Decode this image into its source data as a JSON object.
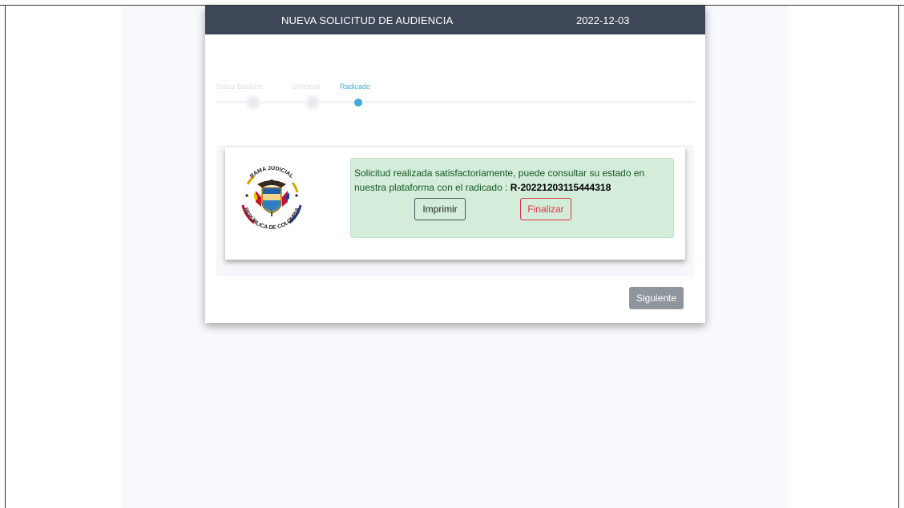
{
  "modal": {
    "title": "NUEVA SOLICITUD DE AUDIENCIA",
    "date": "2022-12-03"
  },
  "stepper": {
    "steps": [
      {
        "label": "Datos Basicos",
        "state": "inactive"
      },
      {
        "label": "Solicitud",
        "state": "inactive"
      },
      {
        "label": "Radicado",
        "state": "active"
      }
    ]
  },
  "seal": {
    "top_text": "RAMA JUDICIAL",
    "bottom_text": "REPÚBLICA DE COLOMBIA",
    "icon": "coat-of-arms-colombia"
  },
  "alert": {
    "message": "Solicitud realizada satisfactoriamente, puede consultar su estado en nuestra plataforma con el radicado : ",
    "code": "R-20221203115444318",
    "print_label": "Imprimir",
    "finish_label": "Finalizar"
  },
  "footer": {
    "next_label": "Siguiente"
  },
  "colors": {
    "header_bg": "#3d4758",
    "accent": "#44a9df",
    "alert_bg": "#d4edda",
    "danger": "#dc3545"
  }
}
